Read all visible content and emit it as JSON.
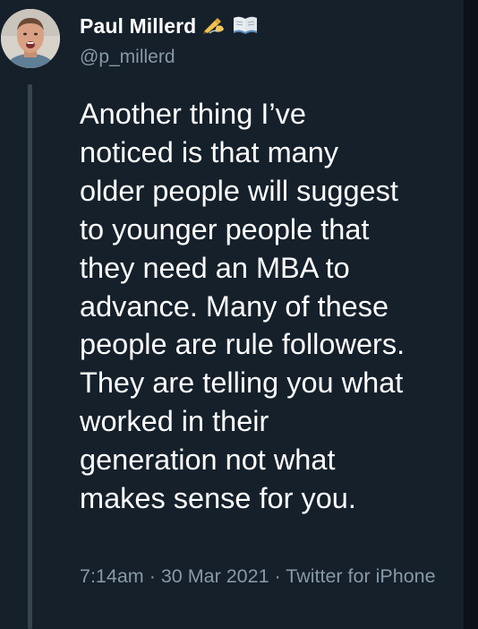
{
  "tweet": {
    "author": {
      "name": "Paul Millerd",
      "name_emoji": "✍️📖",
      "handle": "@p_millerd"
    },
    "text_lines": [
      "Another thing I’ve",
      "noticed is that many",
      "older people will suggest",
      "to younger people that",
      "they need an MBA to",
      "advance. Many of these",
      "people are rule followers.",
      "They are telling you what",
      "worked in their",
      "generation not what",
      "makes sense for you."
    ],
    "meta": {
      "time": "7:14am",
      "separator": " · ",
      "date": "30 Mar 2021",
      "source": "Twitter for iPhone"
    }
  },
  "icons": {
    "emoji": [
      "writing-hand-icon",
      "open-book-icon"
    ],
    "avatar": "avatar"
  },
  "colors": {
    "background": "#15202b",
    "text": "#ffffff",
    "secondary_text": "#8899a6",
    "thread_line": "#38444d"
  }
}
